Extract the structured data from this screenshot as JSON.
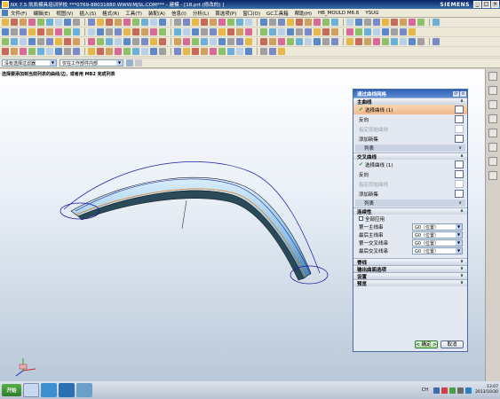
{
  "window": {
    "title": "NX 7.5 凯凯模具培训学校  ***0769-88031880  WWW.MJSL.COM*** - 建模 - [18.prt (修改的) ]",
    "brand": "SIEMENS",
    "min_label": "_",
    "max_label": "□",
    "close_label": "×"
  },
  "menubar": {
    "items": [
      "文件(F)",
      "编辑(E)",
      "视图(V)",
      "插入(S)",
      "格式(R)",
      "工具(T)",
      "装配(A)",
      "信息(I)",
      "分析(L)",
      "首选项(P)",
      "窗口(O)",
      "GC工具箱",
      "帮助(H)",
      "HB_MOULD M6.6",
      "YSUG"
    ]
  },
  "filterbar": {
    "type_filter": "没有选择过滤器",
    "scope": "仅在工作部件内部"
  },
  "viewport": {
    "cue": "选择要添加到当前列表的曲线/边，或者用 MB2 完成列表"
  },
  "dialog": {
    "title": "通过曲线网格",
    "restore_label": "⟳",
    "close_label": "×",
    "primary": {
      "header": "主曲线",
      "select_curve": "选择曲线 (1)",
      "reverse": "反向",
      "specify_origin": "指定原始曲线",
      "add_new_set": "添加新集",
      "list": "列表"
    },
    "cross": {
      "header": "交叉曲线",
      "select_curve": "选择曲线 (1)",
      "reverse": "反向",
      "specify_origin": "指定原始曲线",
      "add_new_set": "添加新集",
      "list": "列表"
    },
    "continuity": {
      "header": "连续性",
      "apply_all": "全部应用",
      "rows": [
        {
          "label": "第一主线串",
          "value": "G0（位置）"
        },
        {
          "label": "最后主线串",
          "value": "G0（位置）"
        },
        {
          "label": "第一交叉线串",
          "value": "G0（位置）"
        },
        {
          "label": "最后交叉线串",
          "value": "G0（位置）"
        }
      ]
    },
    "collapsed_sections": [
      "脊线",
      "输出曲面选项",
      "设置",
      "预览"
    ],
    "ok_label": "< 确定 >",
    "cancel_label": "取消"
  },
  "taskbar": {
    "start_label": "开始",
    "lang": "CH",
    "time": "13:07",
    "date": "2013/10/30"
  },
  "colors": {
    "dialog_active_row": "#f0b98a",
    "surface": "#8ec3e6",
    "curve": "#1a1aa8"
  }
}
